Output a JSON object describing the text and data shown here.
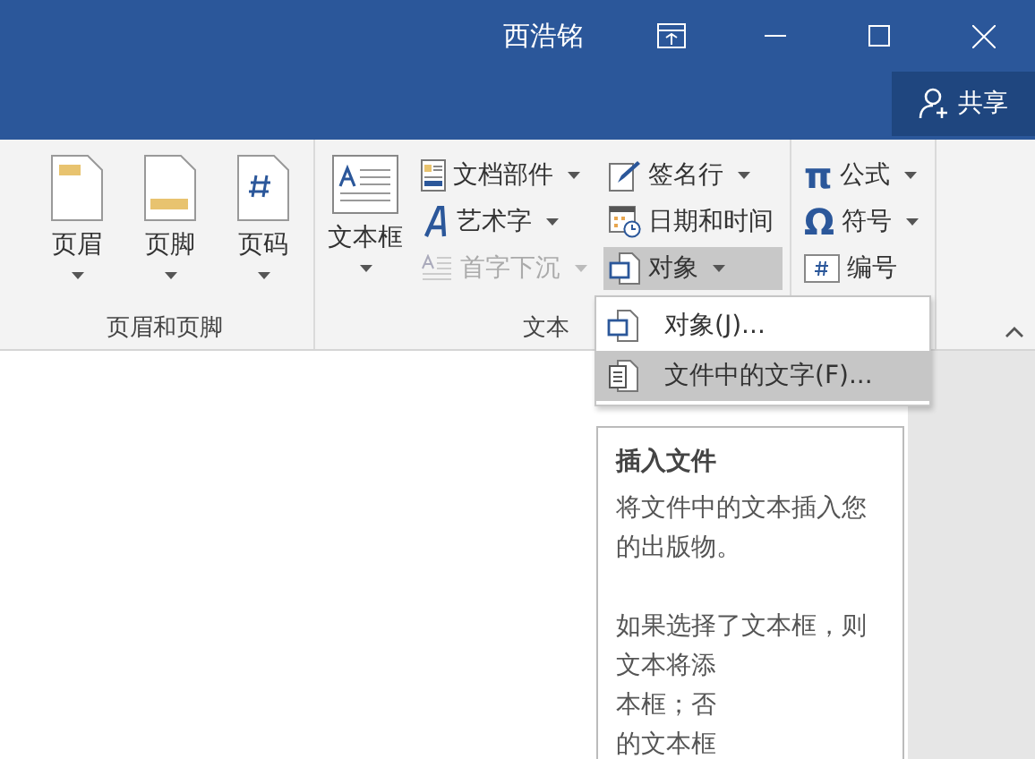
{
  "title_bar": {
    "user": "西浩铭",
    "share": "共享"
  },
  "groups": [
    {
      "label": "页眉和页脚",
      "large_buttons": [
        {
          "label": "页眉",
          "kind": "header",
          "dropdown": true
        },
        {
          "label": "页脚",
          "kind": "footer",
          "dropdown": true
        },
        {
          "label": "页码",
          "kind": "page-number",
          "dropdown": true
        }
      ]
    },
    {
      "label": "文本",
      "large_buttons": [
        {
          "label": "文本框",
          "kind": "textbox",
          "dropdown": true
        }
      ],
      "columns": [
        [
          {
            "label": "文档部件",
            "kind": "parts",
            "dropdown": true,
            "disabled": false,
            "selected": false
          },
          {
            "label": "艺术字",
            "kind": "wordart",
            "dropdown": true,
            "disabled": false,
            "selected": false
          },
          {
            "label": "首字下沉",
            "kind": "dropcap",
            "dropdown": true,
            "disabled": true,
            "selected": false
          }
        ],
        [
          {
            "label": "签名行",
            "kind": "signature",
            "dropdown": true,
            "disabled": false,
            "selected": false
          },
          {
            "label": "日期和时间",
            "kind": "datetime",
            "dropdown": false,
            "disabled": false,
            "selected": false
          },
          {
            "label": "对象",
            "kind": "object",
            "dropdown": true,
            "disabled": false,
            "selected": true
          }
        ]
      ]
    },
    {
      "columns": [
        [
          {
            "label": "公式",
            "kind": "glyph",
            "glyph": "π",
            "dropdown": true,
            "disabled": false,
            "selected": false
          },
          {
            "label": "符号",
            "kind": "glyph",
            "glyph": "Ω",
            "dropdown": true,
            "disabled": false,
            "selected": false
          },
          {
            "label": "编号",
            "kind": "number",
            "dropdown": false,
            "disabled": false,
            "selected": false
          }
        ]
      ]
    }
  ],
  "menu": {
    "items": [
      {
        "label": "对象(J)...",
        "kind": "object",
        "selected": false
      },
      {
        "label": "文件中的文字(F)...",
        "kind": "document",
        "selected": true
      }
    ]
  },
  "tooltip": {
    "title": "插入文件",
    "paragraphs": [
      [
        "将文件中的文本插入您",
        "的出版物。"
      ],
      [
        "如果选择了文本框，则",
        "文本将添",
        "本框；否",
        "的文本框"
      ]
    ]
  }
}
